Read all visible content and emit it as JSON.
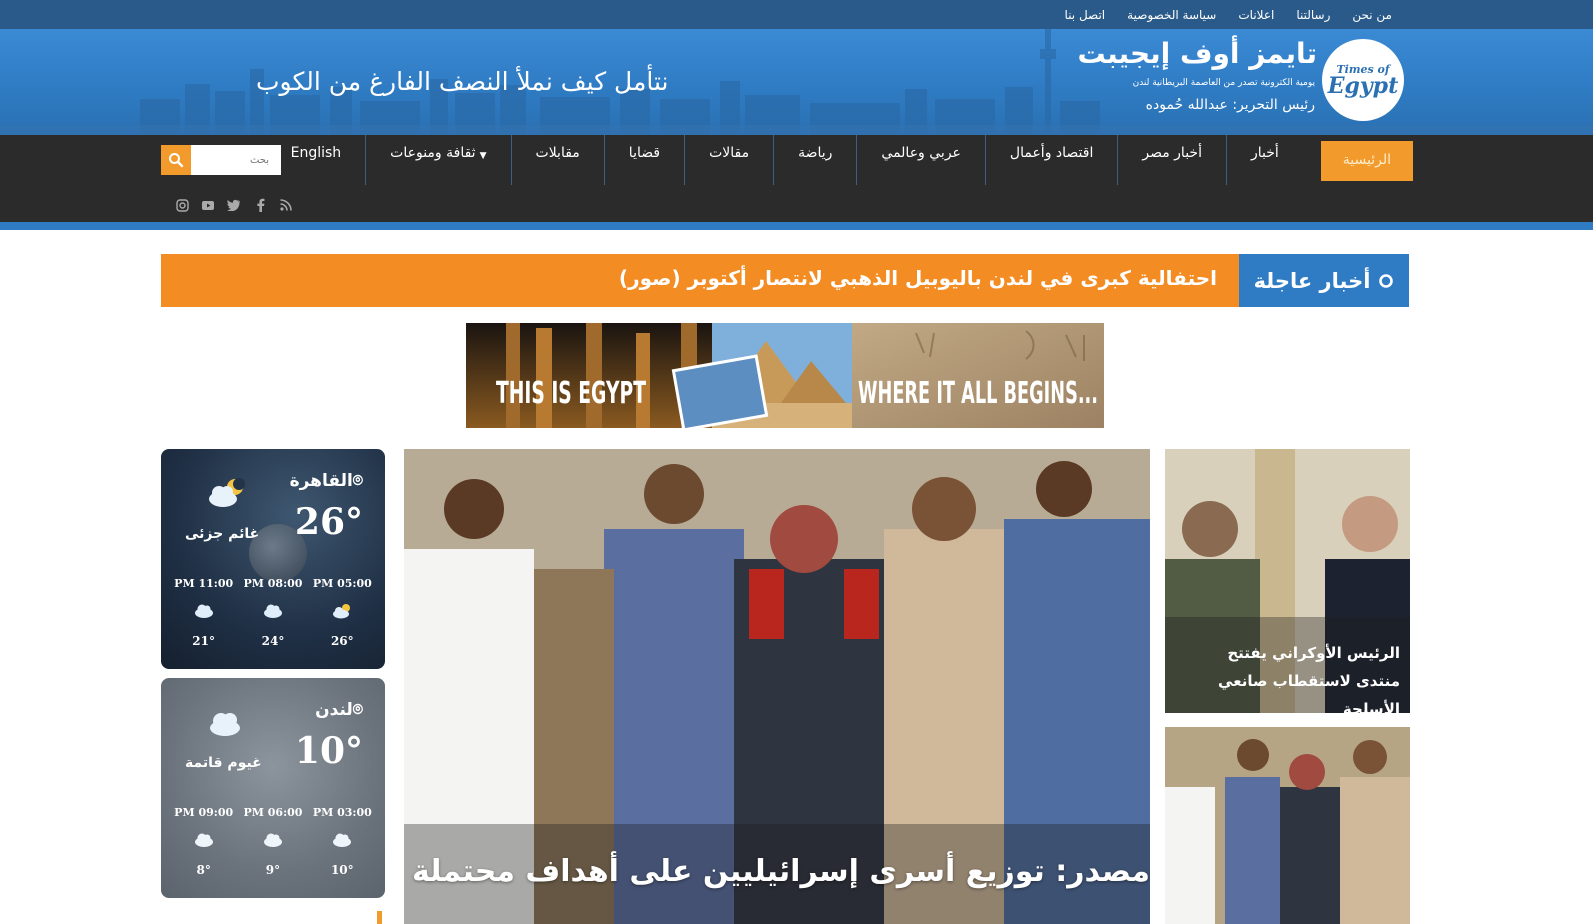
{
  "top_links": [
    "من نحن",
    "رسالتنا",
    "اعلانات",
    "سياسة الخصوصية",
    "اتصل بنا"
  ],
  "header": {
    "slogan": "نتأمل كيف نملأ النصف الفارغ من الكوب",
    "brand_ar": "تايمز أوف إيجيبت",
    "tagline": "يومية الكترونية تصدر من العاصمة البريطانية لندن",
    "editor": "رئيس التحرير: عبدالله حُموده",
    "logo_small": "Times of",
    "logo_big": "Egypt"
  },
  "nav": {
    "items": [
      "الرئيسية",
      "أخبار",
      "أخبار مصر",
      "اقتصاد وأعمال",
      "عربي وعالمي",
      "رياضة",
      "مقالات",
      "قضايا",
      "مقابلات",
      "ثقافة ومنوعات",
      "English"
    ],
    "search_placeholder": "بحث",
    "socials": [
      "rss-icon",
      "facebook-icon",
      "twitter-icon",
      "youtube-icon",
      "instagram-icon"
    ]
  },
  "breaking": {
    "label": "أخبار عاجلة",
    "headline": "احتفالية كبرى في لندن باليوبيل الذهبي لانتصار أكتوبر (صور)"
  },
  "banner": {
    "left_text": "THIS IS EGYPT",
    "right_text": "WHERE IT ALL BEGINS..."
  },
  "weather": [
    {
      "city": "القاهرة",
      "temp": "26°",
      "desc": "غائم جزئى",
      "hours": [
        {
          "time": "PM 05:00",
          "temp": "26°"
        },
        {
          "time": "PM 08:00",
          "temp": "24°"
        },
        {
          "time": "PM 11:00",
          "temp": "21°"
        }
      ]
    },
    {
      "city": "لندن",
      "temp": "10°",
      "desc": "غيوم قاتمة",
      "hours": [
        {
          "time": "PM 03:00",
          "temp": "10°"
        },
        {
          "time": "PM 06:00",
          "temp": "9°"
        },
        {
          "time": "PM 09:00",
          "temp": "8°"
        }
      ]
    }
  ],
  "main_story": {
    "title": "مصدر: توزيع أسرى إسرائيليين على أهداف محتملة"
  },
  "side_stories": [
    {
      "title": "الرئيس الأوكراني يفتتح منتدى لاستقطاب صانعي الأسلحة"
    },
    {
      "title": ""
    }
  ],
  "colors": {
    "topbar": "#2a5a8a",
    "header": "#2f7cc4",
    "nav": "#2b2b2b",
    "accent": "#f29b2c",
    "breaking": "#f28c23"
  }
}
